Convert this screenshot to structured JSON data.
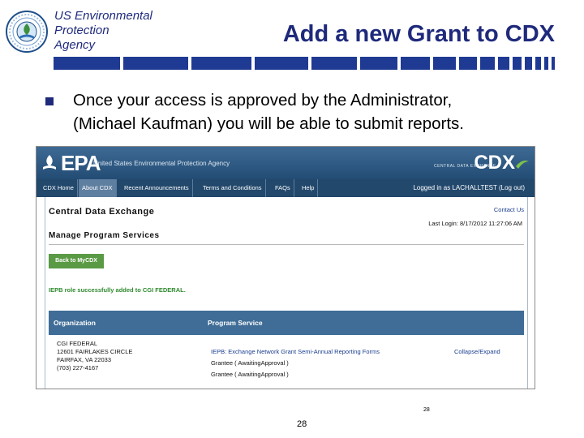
{
  "header": {
    "agency_lines": [
      "US Environmental",
      "Protection",
      "Agency"
    ],
    "title": "Add a new Grant to CDX"
  },
  "bullet": {
    "lines": [
      "Once your access is approved by the Administrator,",
      "(Michael Kaufman) you will be able to submit reports."
    ]
  },
  "screenshot": {
    "banner": {
      "logo_text": "EPA",
      "agency_name": "United States Environmental Protection Agency",
      "tagline": "CENTRAL DATA EXCHANGE",
      "cdx_text": "CDX"
    },
    "nav": {
      "items": [
        "CDX Home",
        "About CDX",
        "Recent Announcements",
        "Terms and Conditions",
        "FAQs",
        "Help"
      ],
      "active_index": 1,
      "logged_in": "Logged in as LACHALLTEST (Log out)"
    },
    "content": {
      "title": "Central Data Exchange",
      "contact": "Contact Us",
      "last_login": "Last Login: 8/17/2012 11:27:06 AM",
      "section_title": "Manage Program Services",
      "back_button": "Back to MyCDX",
      "success_message": "IEPB role successfully added to CGI FEDERAL.",
      "table": {
        "headers": [
          "Organization",
          "Program Service"
        ],
        "org_lines": [
          "CGI FEDERAL",
          "12601 FAIRLAKES CIRCLE",
          "FAIRFAX, VA 22033",
          "(703) 227-4167"
        ],
        "service_link": "IEPB: Exchange Network Grant Semi-Annual Reporting Forms",
        "grant_lines": [
          "Grantee ( AwaitingApproval )",
          "Grantee ( AwaitingApproval )"
        ],
        "collapse": "Collapse/Expand"
      }
    },
    "small_number": "28"
  },
  "footer": {
    "page_number": "28"
  },
  "colors": {
    "title_blue": "#1f2a7c",
    "banner_blue": "#2f5a84",
    "nav_blue": "#22486c",
    "table_header": "#3f6d97",
    "button_green": "#5a9a44",
    "success_green": "#2f8a2f",
    "link_blue": "#1a3d8f"
  }
}
